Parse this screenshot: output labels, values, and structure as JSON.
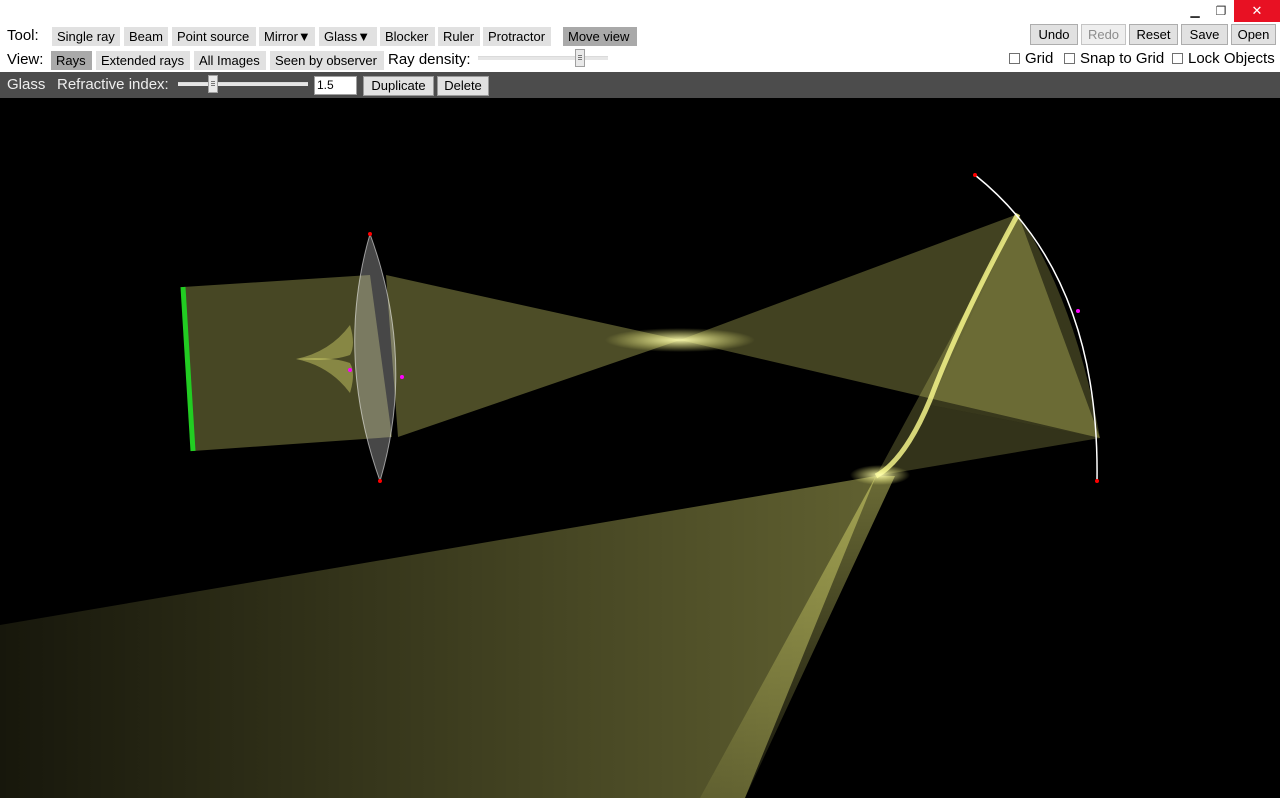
{
  "window": {
    "minimize_icon": "minimize-icon",
    "maximize_icon": "restore-icon",
    "close_icon": "close-icon"
  },
  "tool_row": {
    "label": "Tool:",
    "buttons": [
      "Single ray",
      "Beam",
      "Point source",
      "Mirror▼",
      "Glass▼",
      "Blocker",
      "Ruler",
      "Protractor",
      "Move view"
    ],
    "selected": "Move view"
  },
  "view_row": {
    "label": "View:",
    "buttons": [
      "Rays",
      "Extended rays",
      "All Images",
      "Seen by observer"
    ],
    "selected": "Rays",
    "ray_density_label": "Ray density:"
  },
  "actions": {
    "undo": "Undo",
    "redo": "Redo",
    "reset": "Reset",
    "save": "Save",
    "open": "Open"
  },
  "options": {
    "grid": "Grid",
    "snap_to_grid": "Snap to Grid",
    "lock_objects": "Lock Objects"
  },
  "object_bar": {
    "object_name": "Glass",
    "refractive_index_label": "Refractive index:",
    "refractive_index_value": "1.5",
    "duplicate": "Duplicate",
    "delete": "Delete"
  },
  "colors": {
    "ray": "#ffff80",
    "beam_source": "#22cc22",
    "mirror": "#ffffff",
    "glass": "#ffffff",
    "handle": "#ff0000",
    "background": "#000000"
  }
}
